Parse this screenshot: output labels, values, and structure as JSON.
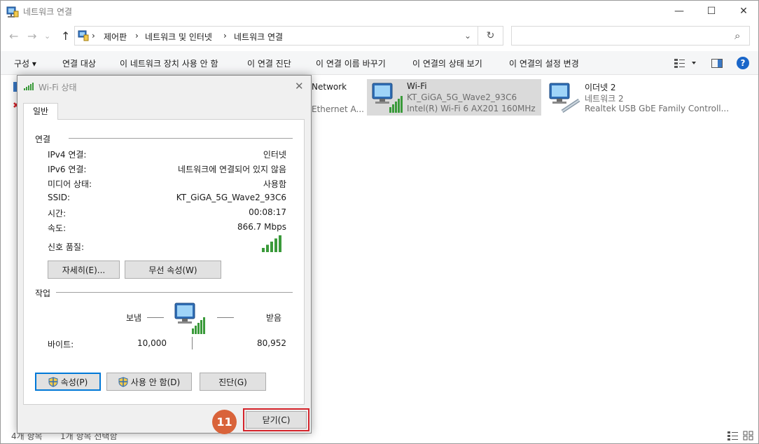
{
  "window": {
    "title": "네트워크 연결",
    "minimize": "—",
    "maximize": "☐",
    "close": "✕"
  },
  "address": {
    "crumbs": [
      "제어판",
      "네트워크 및 인터넷",
      "네트워크 연결"
    ],
    "sep": "›",
    "refresh": "↻",
    "search_icon": "⌕"
  },
  "toolbar": {
    "organize": "구성 ▾",
    "items": [
      "연결 대상",
      "이 네트워크 장치 사용 안 함",
      "이 연결 진단",
      "이 연결 이름 바꾸기",
      "이 연결의 상태 보기",
      "이 연결의 설정 변경"
    ],
    "help": "?"
  },
  "connections": [
    {
      "name": "Network",
      "sub": "Ethernet A..."
    },
    {
      "name": "Wi-Fi",
      "line2": "KT_GiGA_5G_Wave2_93C6",
      "line3": "Intel(R) Wi-Fi 6 AX201 160MHz"
    },
    {
      "name": "이더넷 2",
      "line2": "네트워크 2",
      "line3": "Realtek USB GbE Family Controll..."
    }
  ],
  "status": {
    "items": "4개 항목",
    "selected": "1개 항목 선택함"
  },
  "dialog": {
    "title": "Wi-Fi 상태",
    "close": "✕",
    "tab": "일반",
    "connection_section": "연결",
    "rows": [
      {
        "label": "IPv4 연결:",
        "value": "인터넷"
      },
      {
        "label": "IPv6 연결:",
        "value": "네트워크에 연결되어 있지 않음"
      },
      {
        "label": "미디어 상태:",
        "value": "사용함"
      },
      {
        "label": "SSID:",
        "value": "KT_GiGA_5G_Wave2_93C6"
      },
      {
        "label": "시간:",
        "value": "00:08:17"
      },
      {
        "label": "속도:",
        "value": "866.7 Mbps"
      }
    ],
    "signal_label": "신호 품질:",
    "signal_bars": 5,
    "details_btn": "자세히(E)...",
    "wireless_btn": "무선 속성(W)",
    "activity_section": "작업",
    "sent_label": "보냄",
    "received_label": "받음",
    "bytes_label": "바이트:",
    "bytes_sent": "10,000",
    "bytes_received": "80,952",
    "properties_btn": "속성(P)",
    "disable_btn": "사용 안 함(D)",
    "diagnose_btn": "진단(G)",
    "close_btn": "닫기(C)",
    "step_badge": "11"
  },
  "colors": {
    "signal": "#3a9a3a",
    "highlight": "#d4232a",
    "badge": "#d9633a",
    "selected_item": "#dadada"
  }
}
